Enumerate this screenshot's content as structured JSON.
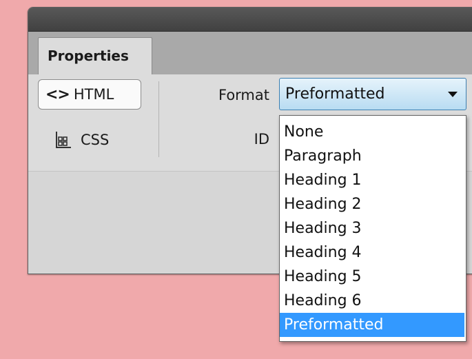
{
  "panel": {
    "tab_label": "Properties",
    "html_button": {
      "icon": "<>",
      "label": "HTML"
    },
    "css_button": {
      "icon": "css-grid-icon",
      "label": "CSS"
    },
    "format": {
      "label": "Format",
      "value": "Preformatted",
      "options": [
        "None",
        "Paragraph",
        "Heading 1",
        "Heading 2",
        "Heading 3",
        "Heading 4",
        "Heading 5",
        "Heading 6",
        "Preformatted"
      ],
      "selected_index": 8
    },
    "id_label": "ID"
  },
  "colors": {
    "background": "#f0a9ab",
    "selected_option": "#3399ff"
  }
}
